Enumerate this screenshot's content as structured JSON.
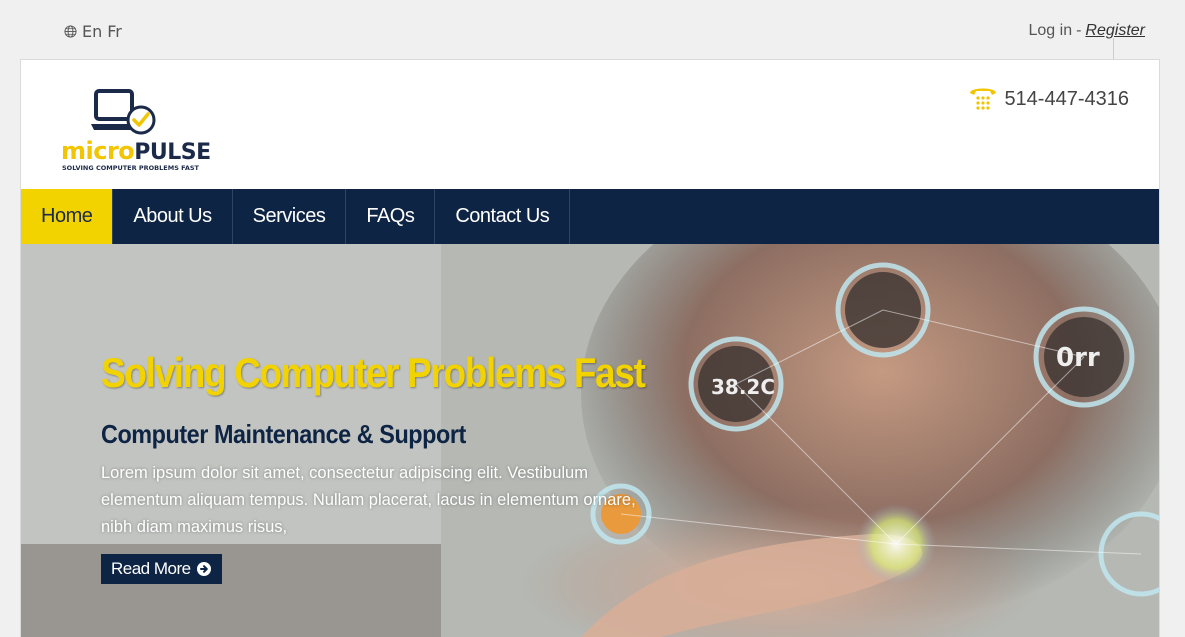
{
  "topbar": {
    "languages": [
      "En",
      "Fr"
    ],
    "login_label": "Log in",
    "separator": "-",
    "register_label": "Register"
  },
  "header": {
    "logo": {
      "word_part1": "micro",
      "word_part2": "PULSE",
      "tagline": "SOLVING COMPUTER PROBLEMS FAST"
    },
    "phone_number": "514-447-4316"
  },
  "nav": {
    "items": [
      {
        "label": "Home",
        "active": true
      },
      {
        "label": "About Us",
        "active": false
      },
      {
        "label": "Services",
        "active": false
      },
      {
        "label": "FAQs",
        "active": false
      },
      {
        "label": "Contact Us",
        "active": false
      }
    ]
  },
  "hero": {
    "title": "Solving Computer Problems Fast",
    "subtitle": "Computer Maintenance & Support",
    "text": "Lorem ipsum dolor sit amet, consectetur adipiscing elit. Vestibulum elementum aliquam tempus. Nullam placerat, lacus in elementum ornare, nibh diam maximus risus,",
    "button_label": "Read More",
    "image_labels": [
      "38.2C",
      "0rr"
    ]
  },
  "colors": {
    "navy": "#0e2444",
    "yellow": "#f2d300",
    "page_background": "#f0f0f0"
  },
  "icons": [
    "globe-icon",
    "phone-icon",
    "arrow-circle-right-icon",
    "laptop-check-icon"
  ]
}
